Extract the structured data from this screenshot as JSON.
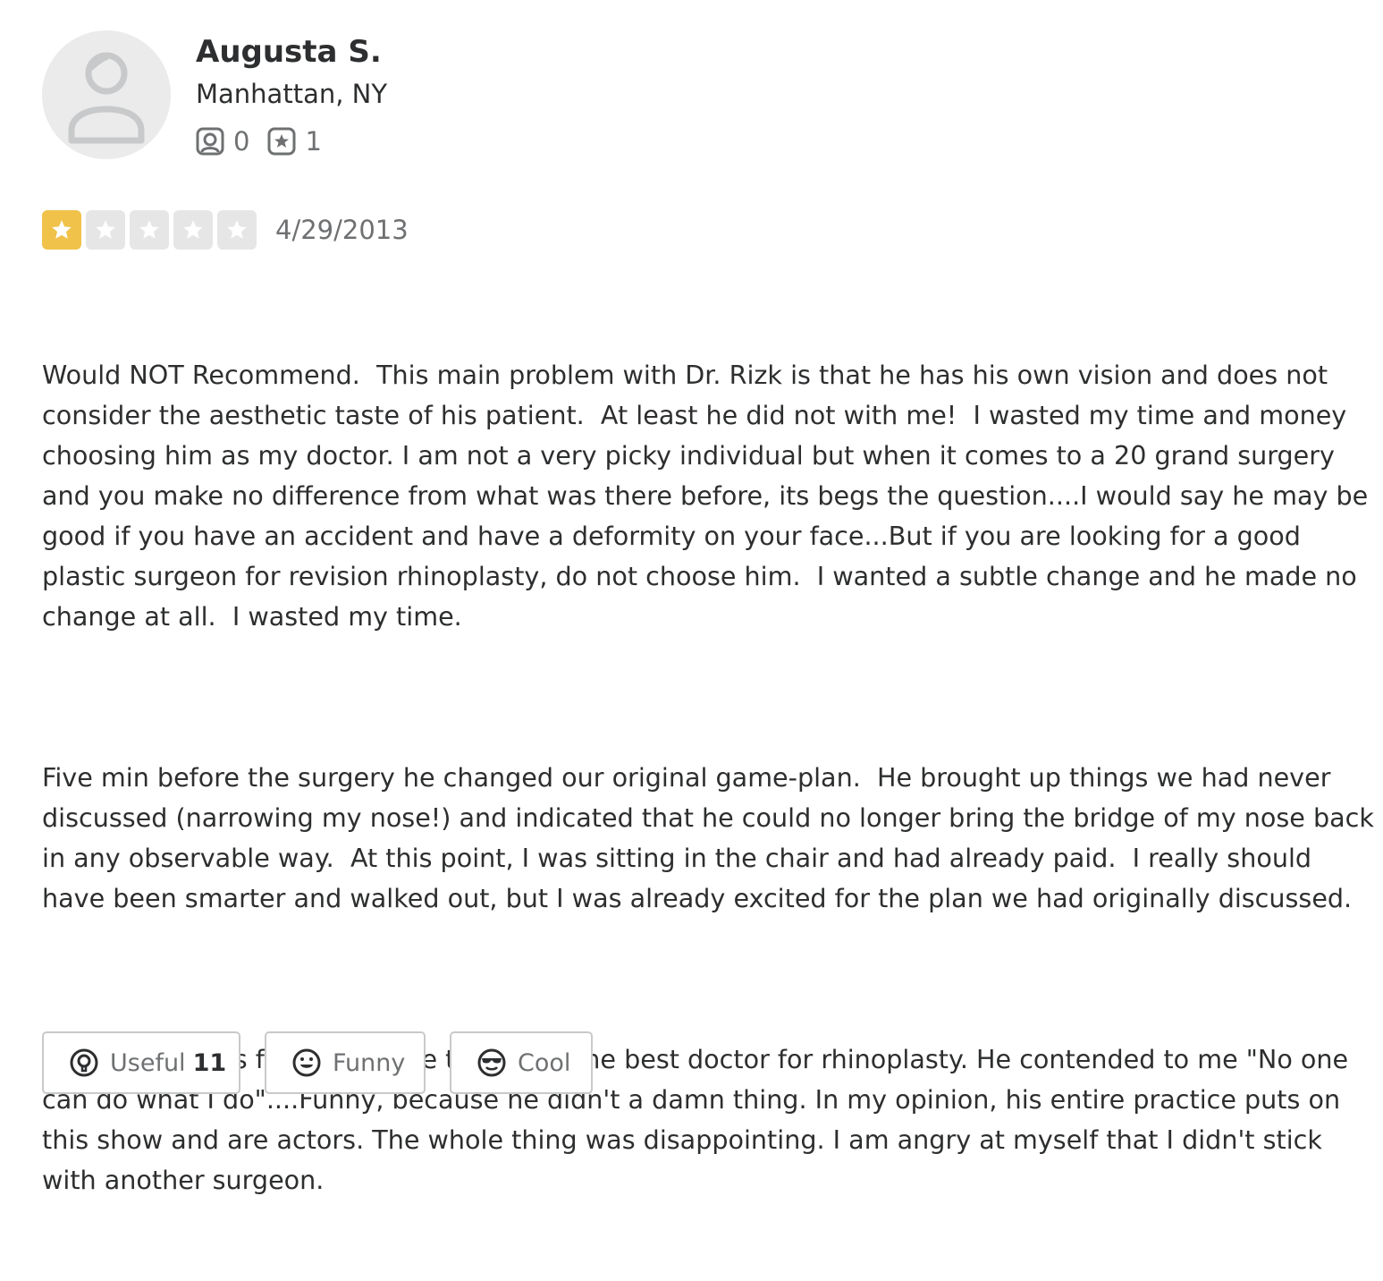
{
  "reviewer": {
    "name": "Augusta S.",
    "location": "Manhattan, NY",
    "friends_count": "0",
    "reviews_count": "1",
    "avatar_icon": "default-user-icon",
    "friends_icon": "friends-icon",
    "reviews_icon": "star-review-icon"
  },
  "review": {
    "rating": 1,
    "rating_max": 5,
    "star_color": "#f0c24a",
    "empty_star_color": "#e6e6e6",
    "date": "4/29/2013",
    "paragraphs": [
      "Would NOT Recommend.  This main problem with Dr. Rizk is that he has his own vision and does not consider the aesthetic taste of his patient.  At least he did not with me!  I wasted my time and money choosing him as my doctor. I am not a very picky individual but when it comes to a 20 grand surgery and you make no difference from what was there before, its begs the question....I would say he may be good if you have an accident and have a deformity on your face...But if you are looking for a good plastic surgeon for revision rhinoplasty, do not choose him.  I wanted a subtle change and he made no change at all.  I wasted my time.",
      "Five min before the surgery he changed our original game-plan.  He brought up things we had never discussed (narrowing my nose!) and indicated that he could no longer bring the bridge of my nose back in any observable way.  At this point, I was sitting in the chair and had already paid.  I really should have been smarter and walked out, but I was already excited for the plan we had originally discussed.",
      "Dr. Rizk has this false pretense that he is the best doctor for rhinoplasty. He contended to me \"No one can do what I do\"....Funny, because he didn't a damn thing. In my opinion, his entire practice puts on this show and are actors. The whole thing was disappointing. I am angry at myself that I didn't stick with another surgeon."
    ]
  },
  "actions": {
    "useful_label": "Useful",
    "useful_count": "11",
    "funny_label": "Funny",
    "cool_label": "Cool",
    "useful_icon": "lightbulb-icon",
    "funny_icon": "smile-icon",
    "cool_icon": "sunglasses-icon"
  }
}
